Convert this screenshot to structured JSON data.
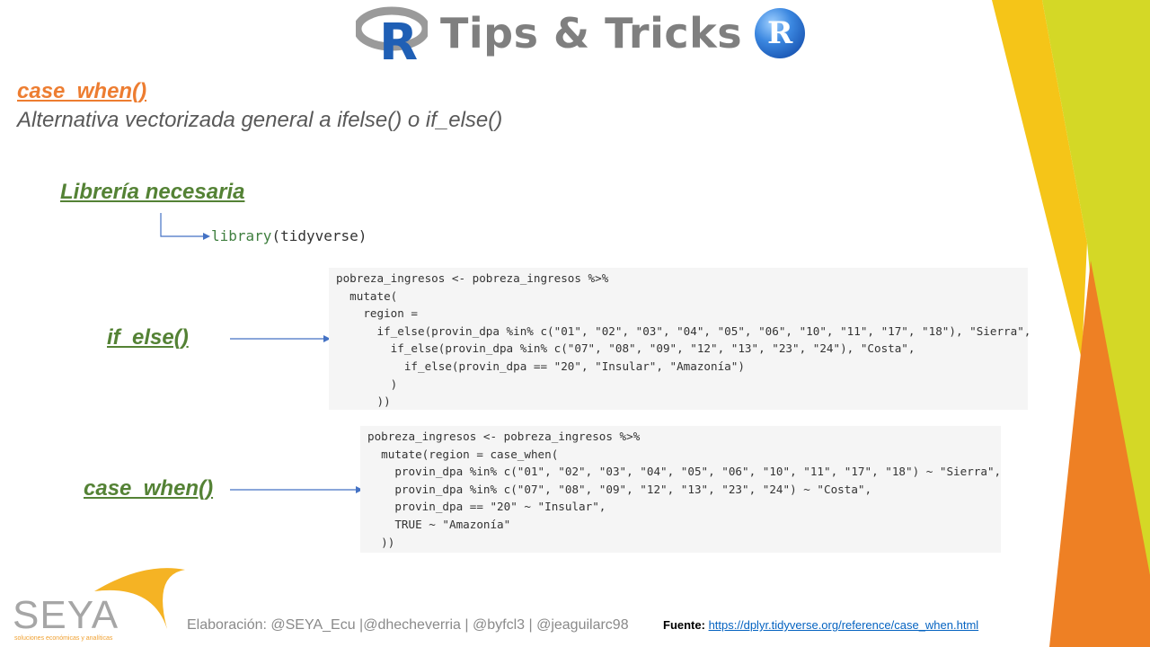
{
  "header": {
    "title": "Tips & Tricks",
    "r_letter": "R"
  },
  "main": {
    "title": "case_when()",
    "subtitle": "Alternativa vectorizada general a ifelse() o if_else()"
  },
  "library_section": {
    "label": "Librería necesaria",
    "code_fn": "library",
    "code_arg": "(tidyverse)"
  },
  "if_else_section": {
    "label": "if_else()",
    "code_lines": [
      "pobreza_ingresos <- pobreza_ingresos %>%",
      "  mutate(",
      "    region =",
      "      if_else(provin_dpa %in% c(\"01\", \"02\", \"03\", \"04\", \"05\", \"06\", \"10\", \"11\", \"17\", \"18\"), \"Sierra\",",
      "        if_else(provin_dpa %in% c(\"07\", \"08\", \"09\", \"12\", \"13\", \"23\", \"24\"), \"Costa\",",
      "          if_else(provin_dpa == \"20\", \"Insular\", \"Amazonía\")",
      "        )",
      "      ))"
    ]
  },
  "case_when_section": {
    "label": "case_when()",
    "code_lines": [
      "pobreza_ingresos <- pobreza_ingresos %>%",
      "  mutate(region = case_when(",
      "    provin_dpa %in% c(\"01\", \"02\", \"03\", \"04\", \"05\", \"06\", \"10\", \"11\", \"17\", \"18\") ~ \"Sierra\",",
      "    provin_dpa %in% c(\"07\", \"08\", \"09\", \"12\", \"13\", \"23\", \"24\") ~ \"Costa\",",
      "    provin_dpa == \"20\" ~ \"Insular\",",
      "    TRUE ~ \"Amazonía\"",
      "  ))"
    ]
  },
  "footer": {
    "logo_text": "SEYA",
    "logo_subtext": "soluciones económicas y analíticas",
    "credits": "Elaboración: @SEYA_Ecu |@dhecheverria | @byfcl3 | @jeaguilarc98",
    "source_label": "Fuente:",
    "source_url": "https://dplyr.tidyverse.org/reference/case_when.html"
  },
  "colors": {
    "accent_orange": "#ed7d31",
    "accent_green": "#548235",
    "deco_yellow": "#f5c518",
    "deco_lime": "#d4d826",
    "deco_orange": "#ee8024"
  }
}
